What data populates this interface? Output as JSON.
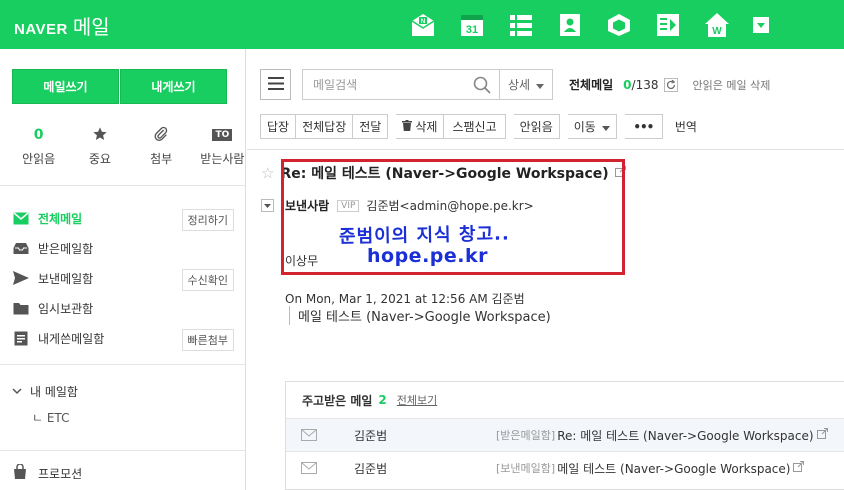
{
  "header": {
    "brand": "NAVER",
    "app_name": "메일",
    "apps": [
      {
        "icon": "mail-app-icon"
      },
      {
        "icon": "calendar-app-icon",
        "label": "31"
      },
      {
        "icon": "list-app-icon"
      },
      {
        "icon": "contacts-app-icon"
      },
      {
        "icon": "cube-app-icon"
      },
      {
        "icon": "memo-app-icon"
      },
      {
        "icon": "home-app-icon",
        "label": "W"
      },
      {
        "icon": "more-dropdown-icon"
      }
    ]
  },
  "sidebar": {
    "compose_label": "메일쓰기",
    "self_compose_label": "내게쓰기",
    "quick": [
      {
        "count": "0",
        "label": "안읽음"
      },
      {
        "icon": "star-icon",
        "label": "중요"
      },
      {
        "icon": "paperclip-icon",
        "label": "첨부"
      },
      {
        "badge": "TO",
        "label": "받는사람"
      }
    ],
    "folders": [
      {
        "label": "전체메일",
        "button": "정리하기",
        "icon": "all-mail-icon"
      },
      {
        "label": "받은메일함",
        "icon": "inbox-icon"
      },
      {
        "label": "보낸메일함",
        "button": "수신확인",
        "icon": "send-icon"
      },
      {
        "label": "임시보관함",
        "icon": "drafts-folder-icon"
      },
      {
        "label": "내게쓴메일함",
        "button": "빠른첨부",
        "icon": "self-mail-icon"
      }
    ],
    "my_mailbox": "내 메일함",
    "sub_folder": "ㄴ ETC",
    "promotion": "프로모션"
  },
  "toolbar": {
    "search_placeholder": "메일검색",
    "detail_label": "상세",
    "all_mail_title": "전체메일",
    "unread_count": "0",
    "total_count": "/138",
    "read_delete": "안읽은 메일 삭제",
    "actions": [
      "답장",
      "전체답장",
      "전달"
    ],
    "delete_label": "삭제",
    "spam_label": "스팸신고",
    "unread_label": "안읽음",
    "move_label": "이동",
    "more_label": "•••",
    "translate_label": "번역"
  },
  "message": {
    "subject": "Re: 메일 테스트 (Naver->Google Workspace)",
    "sender_label": "보낸사람",
    "vip": "VIP",
    "sender": "김준범<admin@hope.pe.kr>",
    "recipient": "이상무",
    "annotation_line1": "준범이의 지식 창고..",
    "annotation_line2": "hope.pe.kr",
    "quote_header": "On Mon, Mar 1, 2021 at 12:56 AM 김준범",
    "quote_body": "메일 테스트 (Naver->Google Workspace)"
  },
  "thread": {
    "title": "주고받은 메일",
    "count": "2",
    "view_all": "전체보기",
    "rows": [
      {
        "name": "김준범",
        "folder": "[받은메일함]",
        "subject": "Re: 메일 테스트 (Naver->Google Workspace)"
      },
      {
        "name": "김준범",
        "folder": "[보낸메일함]",
        "subject": "메일 테스트 (Naver->Google Workspace)"
      }
    ]
  },
  "colors": {
    "brand": "#19ce60",
    "highlight": "#d2232f",
    "annotation": "#1b2fd6"
  }
}
